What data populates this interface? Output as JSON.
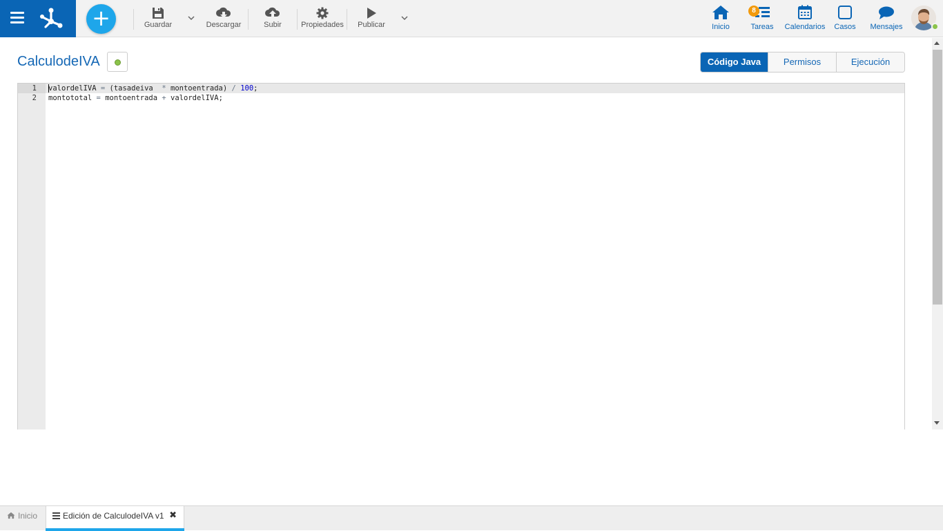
{
  "toolbar": {
    "add_label": "+",
    "save": "Guardar",
    "download": "Descargar",
    "upload": "Subir",
    "properties": "Propiedades",
    "publish": "Publicar"
  },
  "nav": {
    "home": "Inicio",
    "tasks": "Tareas",
    "tasks_badge": "8",
    "calendars": "Calendarios",
    "cases": "Casos",
    "messages": "Mensajes"
  },
  "page": {
    "title": "CalculodeIVA",
    "status_color": "#8bc34a"
  },
  "tabs": {
    "java_code": "Código Java",
    "permissions": "Permisos",
    "execution": "Ejecución",
    "active": "Código Java"
  },
  "editor": {
    "line_numbers": [
      "1",
      "2"
    ],
    "line1": {
      "part1": "valordelIVA ",
      "eq": "=",
      "part2": " (tasadeiva  ",
      "mul": "*",
      "part3": " montoentrada) ",
      "div": "/",
      "space": " ",
      "num": "100",
      "end": ";"
    },
    "line2": {
      "part1": "montototal ",
      "eq": "=",
      "part2": " montoentrada ",
      "plus": "+",
      "part3": " valordelIVA;"
    }
  },
  "bottom_tabs": {
    "home": "Inicio",
    "edit": "Edición de CalculodeIVA v1",
    "close": "✖"
  },
  "colors": {
    "brand": "#0a65b5",
    "accent": "#1ea6ea",
    "badge": "#f29a0c"
  },
  "icons": {
    "menu": "hamburger-icon",
    "logo": "app-logo-icon",
    "save": "floppy-disk-icon",
    "download": "cloud-download-icon",
    "upload": "cloud-upload-icon",
    "properties": "gear-icon",
    "publish": "play-icon",
    "home": "home-icon",
    "tasks": "task-list-icon",
    "calendars": "calendar-icon",
    "cases": "square-icon",
    "messages": "chat-bubble-icon"
  }
}
